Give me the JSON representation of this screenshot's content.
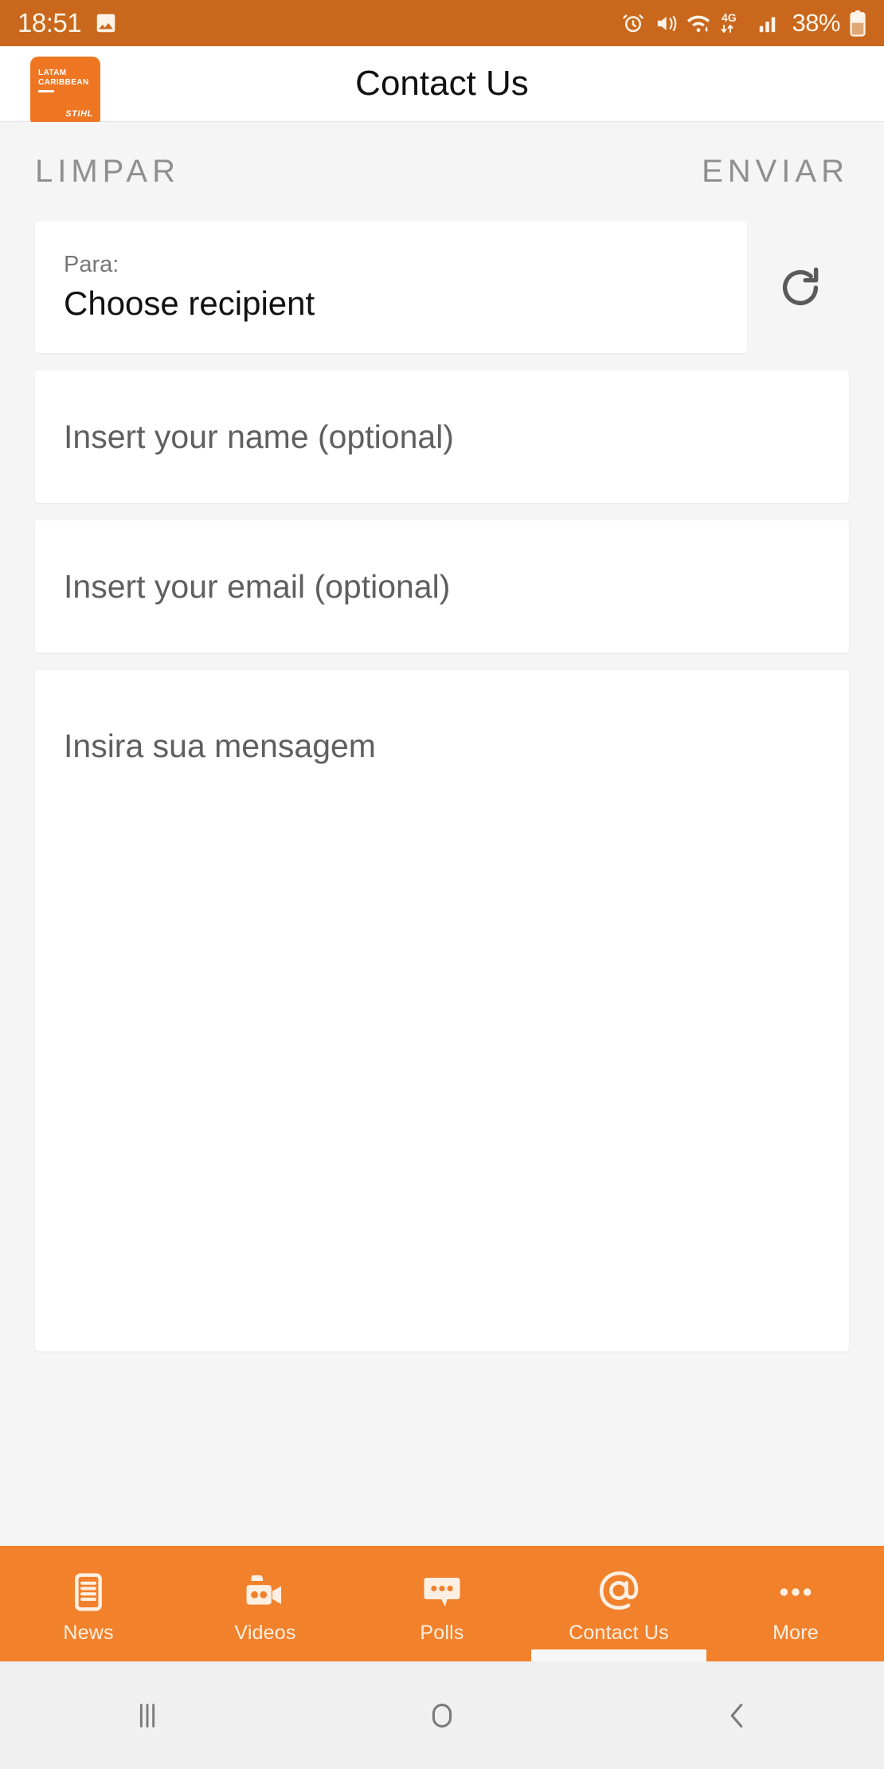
{
  "status_bar": {
    "time": "18:51",
    "battery_percent": "38%",
    "icons": [
      "image-icon",
      "alarm-icon",
      "mute-vibrate-icon",
      "wifi-icon",
      "4g-icon",
      "signal-icon",
      "battery-icon"
    ],
    "network_label": "4G",
    "background_color": "#c9681c"
  },
  "app_bar": {
    "title": "Contact Us",
    "logo": {
      "line1": "LATAM",
      "line2": "CARIBBEAN",
      "brand": "STIHL",
      "color": "#ee7623"
    }
  },
  "actions": {
    "clear_label": "LIMPAR",
    "send_label": "ENVIAR"
  },
  "form": {
    "recipient": {
      "label": "Para:",
      "value": "Choose recipient"
    },
    "refresh_icon": "refresh-icon",
    "name_placeholder": "Insert your name (optional)",
    "email_placeholder": "Insert your email (optional)",
    "message_placeholder": "Insira sua mensagem"
  },
  "bottom_nav": {
    "accent_color": "#f2812c",
    "active": "Contact Us",
    "items": [
      {
        "label": "News",
        "icon": "news-document-icon"
      },
      {
        "label": "Videos",
        "icon": "video-camera-icon"
      },
      {
        "label": "Polls",
        "icon": "chat-bubble-icon"
      },
      {
        "label": "Contact Us",
        "icon": "at-sign-icon"
      },
      {
        "label": "More",
        "icon": "ellipsis-icon"
      }
    ]
  },
  "android_nav": {
    "recents": "recents-icon",
    "home": "home-icon",
    "back": "back-icon"
  }
}
